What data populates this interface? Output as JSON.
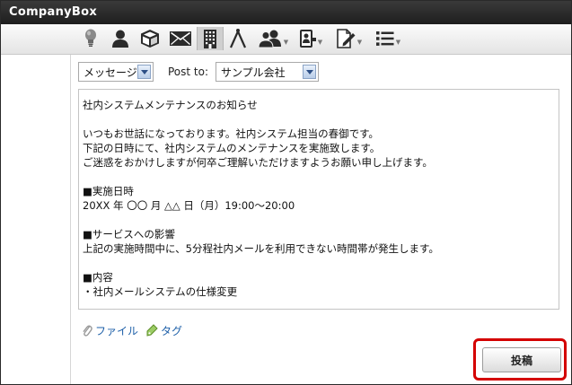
{
  "app": {
    "title": "CompanyBox"
  },
  "toolbar": {
    "icons": [
      {
        "name": "lightbulb-icon",
        "active": false
      },
      {
        "name": "user-icon",
        "active": false
      },
      {
        "name": "box-icon",
        "active": false
      },
      {
        "name": "mail-icon",
        "active": false
      },
      {
        "name": "building-icon",
        "active": true
      },
      {
        "name": "compass-icon",
        "active": false
      },
      {
        "name": "group-icon",
        "active": false,
        "dropdown": true
      },
      {
        "name": "contact-card-icon",
        "active": false,
        "dropdown": true
      },
      {
        "name": "document-edit-icon",
        "active": false,
        "dropdown": true
      },
      {
        "name": "list-icon",
        "active": false,
        "dropdown": true
      }
    ]
  },
  "compose": {
    "type_select": "メッセージ",
    "post_to_label": "Post to:",
    "recipient_select": "サンプル会社",
    "body_lines": [
      "社内システムメンテナンスのお知らせ",
      "",
      "いつもお世話になっております。社内システム担当の春御です。",
      "下記の日時にて、社内システムのメンテナンスを実施致します。",
      "ご迷惑をおかけしますが何卒ご理解いただけますようお願い申し上げます。",
      "",
      "■実施日時",
      "20XX 年 〇〇 月 △△ 日（月）19:00～20:00",
      "",
      "■サービスへの影響",
      "上記の実施時間中に、5分程社内メールを利用できない時間帯が発生します。",
      "",
      "■内容",
      "・社内メールシステムの仕様変更"
    ],
    "file_link": "ファイル",
    "tag_link": "タグ",
    "post_button": "投稿"
  },
  "colors": {
    "titlebar": "#1e1e1e",
    "link": "#1d5fa8",
    "highlight": "#d40000"
  }
}
